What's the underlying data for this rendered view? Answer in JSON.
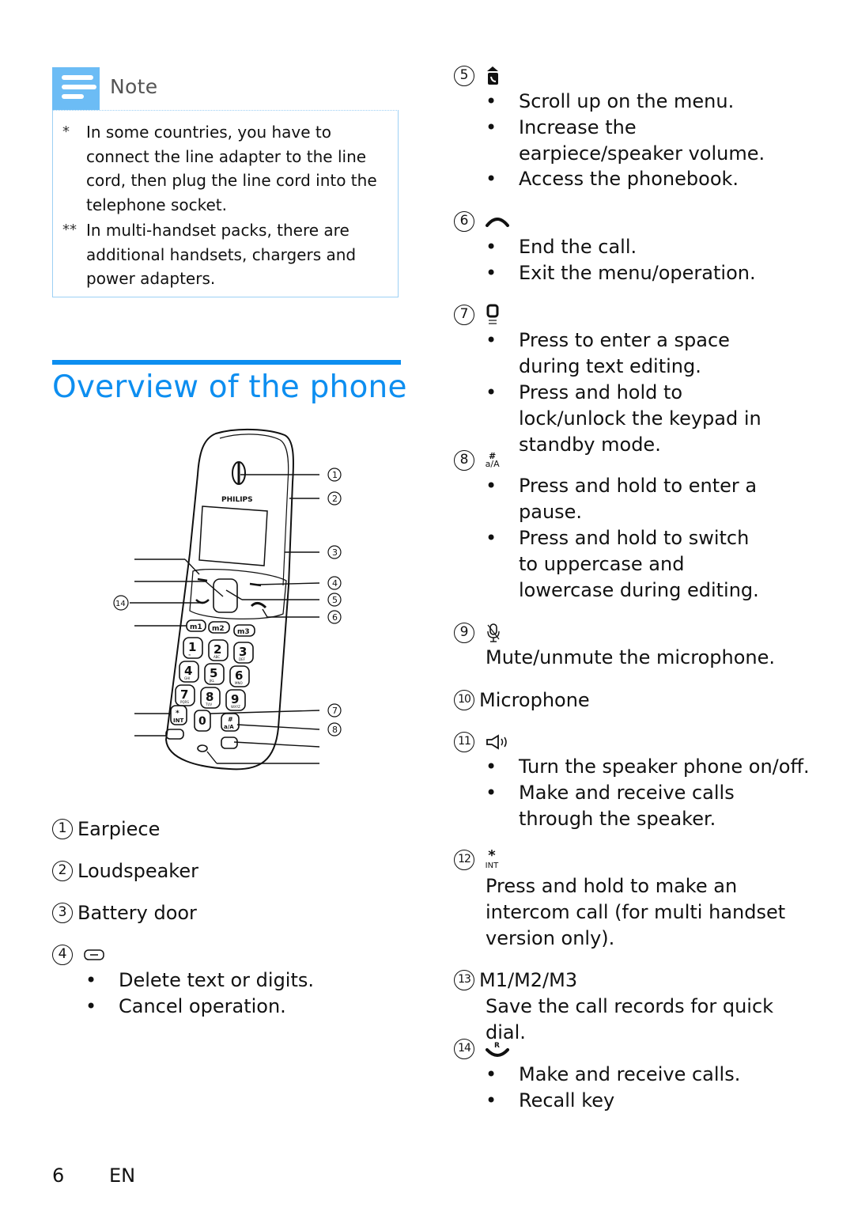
{
  "note": {
    "title": "Note",
    "items": [
      {
        "mark": "*",
        "text_lines": [
          "In some countries, you have to",
          "connect the line adapter to the line",
          "cord, then plug the line cord into the",
          "telephone socket."
        ]
      },
      {
        "mark": "**",
        "text_lines": [
          "In multi-handset packs, there are",
          "additional handsets, chargers and",
          "power adapters."
        ]
      }
    ]
  },
  "section": {
    "title": "Overview of the phone"
  },
  "figure": {
    "brand": "PHILIPS",
    "callouts_right": [
      "1",
      "2",
      "3",
      "4",
      "5",
      "6",
      "7",
      "8"
    ],
    "callouts_left": [
      "14"
    ],
    "keys": {
      "memory": [
        "m1",
        "m2",
        "m3"
      ],
      "digits": [
        {
          "d": "1",
          "s": "∞"
        },
        {
          "d": "2",
          "s": "ABC"
        },
        {
          "d": "3",
          "s": "DEF"
        },
        {
          "d": "4",
          "s": "GHI"
        },
        {
          "d": "5",
          "s": "JKL"
        },
        {
          "d": "6",
          "s": "MNO"
        },
        {
          "d": "7",
          "s": "PQRS"
        },
        {
          "d": "8",
          "s": "TUV"
        },
        {
          "d": "9",
          "s": "WXYZ"
        }
      ],
      "star": "*",
      "star_sub": "INT",
      "zero": "0",
      "hash": "#",
      "hash_sub": "a/A"
    }
  },
  "left_list": [
    {
      "num": "1",
      "label": "Earpiece"
    },
    {
      "num": "2",
      "label": "Loudspeaker"
    },
    {
      "num": "3",
      "label": "Battery door"
    },
    {
      "num": "4",
      "icon": "back-clear-key-icon",
      "bullets": [
        "Delete text or digits.",
        "Cancel operation."
      ]
    }
  ],
  "right_list": [
    {
      "num": "5",
      "icon": "phonebook-up-icon",
      "bullets": [
        "Scroll up on the menu.",
        "Increase the earpiece/speaker volume.",
        "Access the phonebook."
      ]
    },
    {
      "num": "6",
      "icon": "end-call-icon",
      "bullets": [
        "End the call.",
        "Exit the menu/operation."
      ]
    },
    {
      "num": "7",
      "icon": "zero-key-icon",
      "bullets": [
        "Press to enter a space during text editing.",
        "Press and hold to lock/unlock the keypad in standby mode."
      ]
    },
    {
      "num": "8",
      "icon": "hash-key-icon",
      "icon_text_top": "#",
      "icon_text_bottom": "a/A",
      "bullets": [
        "Press and hold to enter a pause.",
        "Press and hold to switch to uppercase and lowercase during editing."
      ]
    },
    {
      "num": "9",
      "icon": "mute-microphone-icon",
      "text": "Mute/unmute the microphone."
    },
    {
      "num": "10",
      "label": "Microphone"
    },
    {
      "num": "11",
      "icon": "speaker-icon",
      "bullets": [
        "Turn the speaker phone on/off.",
        "Make and receive calls through the speaker."
      ]
    },
    {
      "num": "12",
      "icon": "star-int-key-icon",
      "icon_text_top": "*",
      "icon_text_bottom": "INT",
      "text": "Press and hold to make an intercom call (for multi handset version only)."
    },
    {
      "num": "13",
      "label": "M1/M2/M3",
      "text": "Save the call records for quick dial."
    },
    {
      "num": "14",
      "icon": "talk-recall-icon",
      "icon_text_top": "R",
      "bullets": [
        "Make and receive calls.",
        "Recall key"
      ]
    }
  ],
  "footer": {
    "page_number": "6",
    "language": "EN"
  },
  "colors": {
    "accent": "#0d8ef0",
    "note_tab": "#6cbcf5",
    "note_border": "#9dd0f4"
  }
}
